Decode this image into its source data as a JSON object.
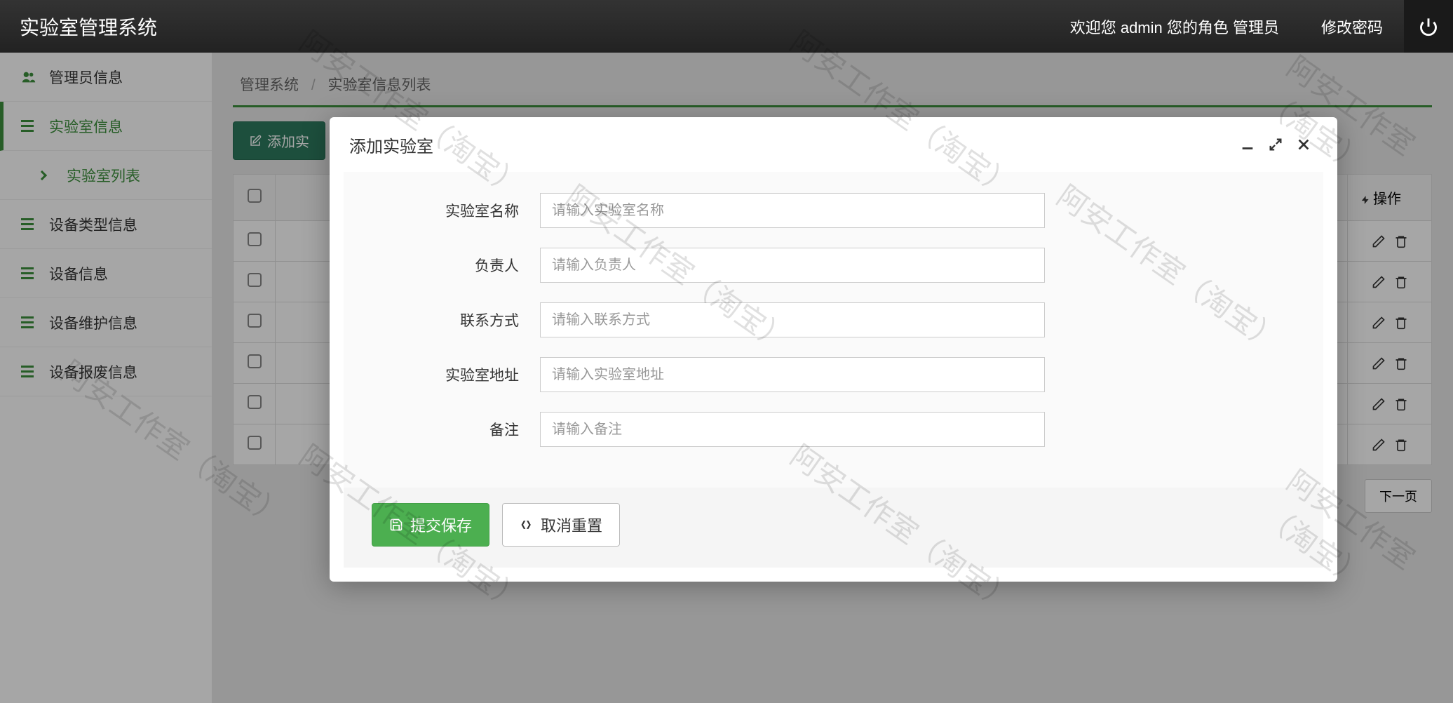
{
  "header": {
    "title": "实验室管理系统",
    "welcome": "欢迎您 admin 您的角色 管理员",
    "change_password": "修改密码"
  },
  "sidebar": {
    "items": [
      {
        "label": "管理员信息",
        "icon": "user-group"
      },
      {
        "label": "实验室信息",
        "icon": "hamburger",
        "active": true
      },
      {
        "label": "实验室列表",
        "icon": "chevron",
        "sub": true
      },
      {
        "label": "设备类型信息",
        "icon": "hamburger"
      },
      {
        "label": "设备信息",
        "icon": "hamburger"
      },
      {
        "label": "设备维护信息",
        "icon": "hamburger"
      },
      {
        "label": "设备报废信息",
        "icon": "hamburger"
      }
    ]
  },
  "breadcrumb": {
    "root": "管理系统",
    "current": "实验室信息列表"
  },
  "toolbar": {
    "add_label": "添加实"
  },
  "table": {
    "action_header": "操作",
    "rows": 6
  },
  "pager": {
    "next": "下一页"
  },
  "modal": {
    "title": "添加实验室",
    "fields": [
      {
        "label": "实验室名称",
        "placeholder": "请输入实验室名称"
      },
      {
        "label": "负责人",
        "placeholder": "请输入负责人"
      },
      {
        "label": "联系方式",
        "placeholder": "请输入联系方式"
      },
      {
        "label": "实验室地址",
        "placeholder": "请输入实验室地址"
      },
      {
        "label": "备注",
        "placeholder": "请输入备注"
      }
    ],
    "submit": "提交保存",
    "cancel": "取消重置"
  },
  "watermark_text": "阿安工作室（淘宝）"
}
